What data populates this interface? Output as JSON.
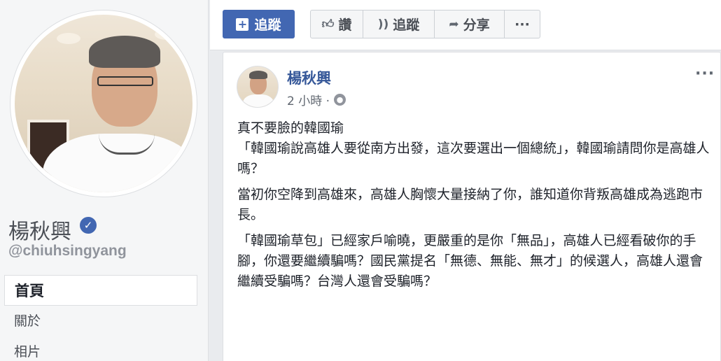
{
  "profile": {
    "name": "楊秋興",
    "username": "@chiuhsingyang"
  },
  "nav": {
    "items": [
      {
        "label": "首頁"
      },
      {
        "label": "關於"
      },
      {
        "label": "相片"
      }
    ]
  },
  "actions": {
    "follow_primary": "追蹤",
    "like": "讚",
    "follow": "追蹤",
    "share": "分享",
    "more": "···"
  },
  "post": {
    "author": "楊秋興",
    "time": "2 小時 ·",
    "paragraphs": [
      "真不要臉的韓國瑜\n「￼韓國瑜說高雄人要從南方出發，這次要選出一個總統￼」，韓國瑜請問你是高雄人嗎￼？",
      "當初你空降到高雄來，高雄人胸懷大量￼￼接納了你，￼誰知道你背叛高雄成為￼逃跑市長￼。",
      "「韓國瑜￼草包」已經家戶喻曉，更嚴重的是你「無品」，￼￼高雄人已經￼看破你的手腳，你還要繼續騙嗎？國民黨提名「￼無德、無能、無才」的￼￼候選人，￼高雄人還會繼續受騙嗎？台灣人還會受騙嗎？￼￼",
      "￼"
    ]
  },
  "colors": {
    "brand": "#4267b2",
    "link": "#365899"
  }
}
